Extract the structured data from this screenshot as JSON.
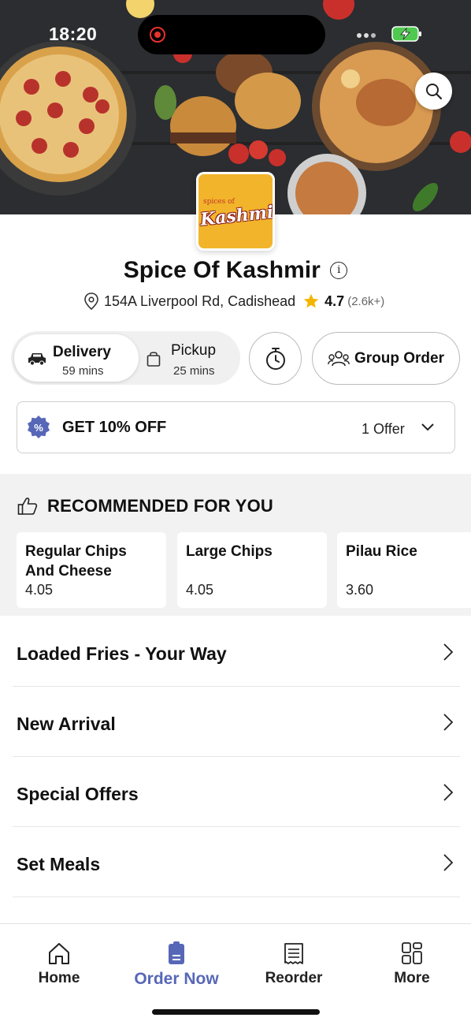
{
  "status_bar": {
    "time": "18:20"
  },
  "restaurant": {
    "logo_small_text": "spices of",
    "logo_text": "Kashmir",
    "name": "Spice Of Kashmir",
    "address": "154A Liverpool Rd, Cadishead",
    "rating": "4.7",
    "rating_count": "(2.6k+)"
  },
  "order_mode": {
    "delivery_label": "Delivery",
    "delivery_time": "59 mins",
    "pickup_label": "Pickup",
    "pickup_time": "25 mins",
    "selected": "Delivery"
  },
  "group_order_label": "Group Order",
  "offer": {
    "title": "GET 10% OFF",
    "count_label": "1 Offer"
  },
  "recommended": {
    "heading": "RECOMMENDED FOR YOU",
    "items": [
      {
        "name": "Regular Chips And Cheese",
        "price": "4.05"
      },
      {
        "name": "Large Chips",
        "price": "4.05"
      },
      {
        "name": "Pilau Rice",
        "price": "3.60"
      }
    ]
  },
  "categories": [
    {
      "label": "Loaded Fries - Your Way"
    },
    {
      "label": "New Arrival"
    },
    {
      "label": "Special Offers"
    },
    {
      "label": "Set Meals"
    }
  ],
  "bottom_nav": {
    "items": [
      {
        "label": "Home",
        "icon": "home-icon"
      },
      {
        "label": "Order Now",
        "icon": "order-icon"
      },
      {
        "label": "Reorder",
        "icon": "receipt-icon"
      },
      {
        "label": "More",
        "icon": "grid-icon"
      }
    ],
    "active": "Order Now"
  },
  "colors": {
    "accent": "#5767b8",
    "logo_bg": "#f2b42a",
    "star": "#f5b400"
  }
}
